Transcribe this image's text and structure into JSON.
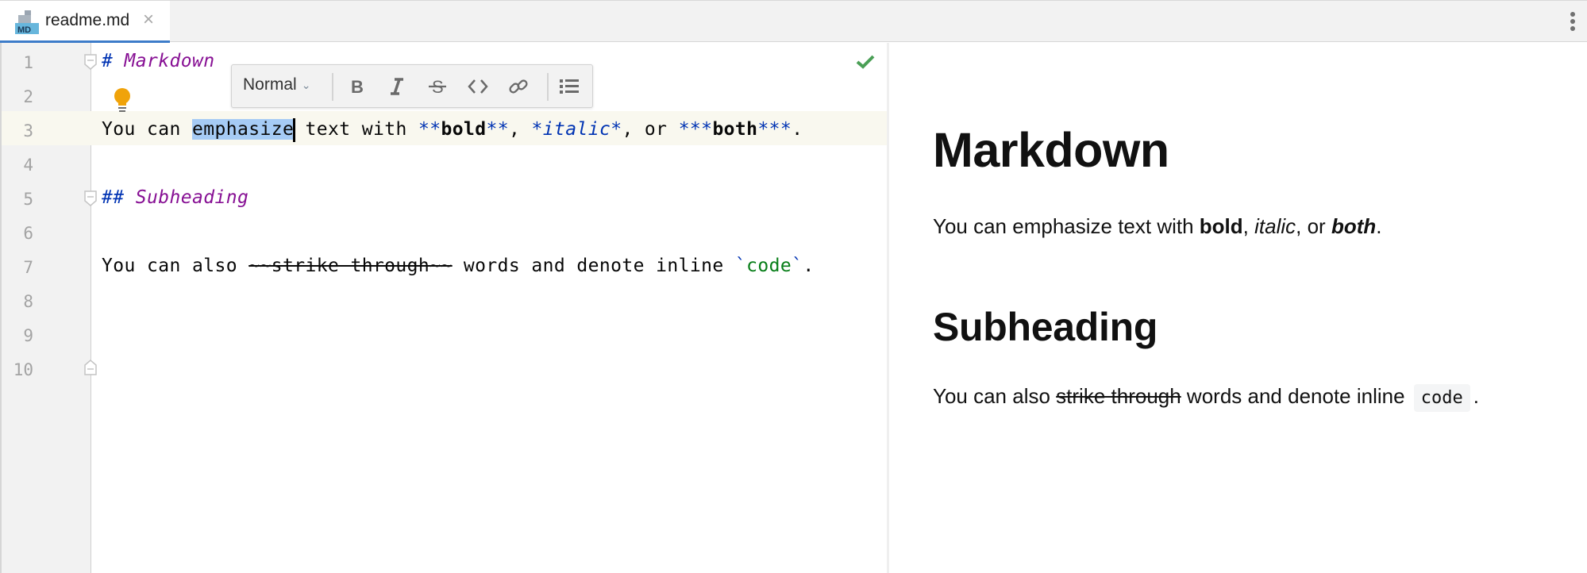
{
  "tab": {
    "filename": "readme.md",
    "icon": "markdown-file-icon",
    "icon_label": "MD",
    "close": "×"
  },
  "colors": {
    "tab_accent": "#3d7cc9",
    "selection": "#a6cbf5",
    "current_line": "#f9f8ef",
    "heading": "#871094",
    "markup": "#0033b3",
    "code": "#067d17",
    "check": "#4a9f56",
    "bulb": "#f0a30a"
  },
  "editor": {
    "line_numbers": [
      "1",
      "2",
      "3",
      "4",
      "5",
      "6",
      "7",
      "8",
      "9",
      "10"
    ],
    "current_line": 3,
    "lines": {
      "l1": {
        "hash": "#",
        "text": " Markdown"
      },
      "l3": {
        "pre": "You can ",
        "selected": "emphasize",
        "mid": " text with ",
        "b_open": "**",
        "bold": "bold",
        "b_close": "**",
        "c1": ", ",
        "i_open": "*",
        "italic": "italic",
        "i_close": "*",
        "c2": ", or ",
        "bi_open": "***",
        "both": "both",
        "bi_close": "***",
        "end": "."
      },
      "l5": {
        "hash": "##",
        "text": " Subheading"
      },
      "l7": {
        "pre": "You can also ",
        "strike": "~~strike through~~",
        "mid": " words and denote inline ",
        "tick_open": "`",
        "code": "code",
        "tick_close": "`",
        "end": "."
      }
    },
    "inspection_status": "no-problems",
    "intention_icon": "lightbulb-icon"
  },
  "format_toolbar": {
    "style_select": "Normal",
    "buttons": [
      "bold",
      "italic",
      "strikethrough",
      "code",
      "link",
      "bulleted-list"
    ]
  },
  "preview": {
    "h1": "Markdown",
    "p1": {
      "pre": "You can emphasize text with ",
      "bold": "bold",
      "c1": ", ",
      "italic": "italic",
      "c2": ", or ",
      "both": "both",
      "end": "."
    },
    "h2": "Subheading",
    "p2": {
      "pre": "You can also ",
      "strike": "strike through",
      "mid": " words and denote inline ",
      "code": "code",
      "end": "."
    }
  }
}
